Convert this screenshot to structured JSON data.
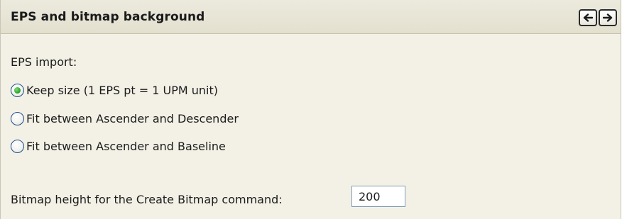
{
  "section": {
    "title": "EPS and bitmap background",
    "nav": {
      "back_icon": "arrow-left-icon",
      "forward_icon": "arrow-right-icon"
    }
  },
  "eps_import": {
    "label": "EPS import:",
    "selected": "keep-size",
    "options": [
      {
        "id": "keep-size",
        "label": "Keep size (1 EPS pt = 1 UPM unit)",
        "checked": true
      },
      {
        "id": "fit-ascender-descender",
        "label": "Fit between Ascender and Descender",
        "checked": false
      },
      {
        "id": "fit-ascender-baseline",
        "label": "Fit between Ascender and Baseline",
        "checked": false
      }
    ]
  },
  "bitmap": {
    "label": "Bitmap height for the Create Bitmap command:",
    "value": "200"
  },
  "colors": {
    "panel_background": "#f3f1e6",
    "header_background": "#e6e3d3",
    "radio_selected": "#2ea82e",
    "input_border": "#7f9db9"
  }
}
